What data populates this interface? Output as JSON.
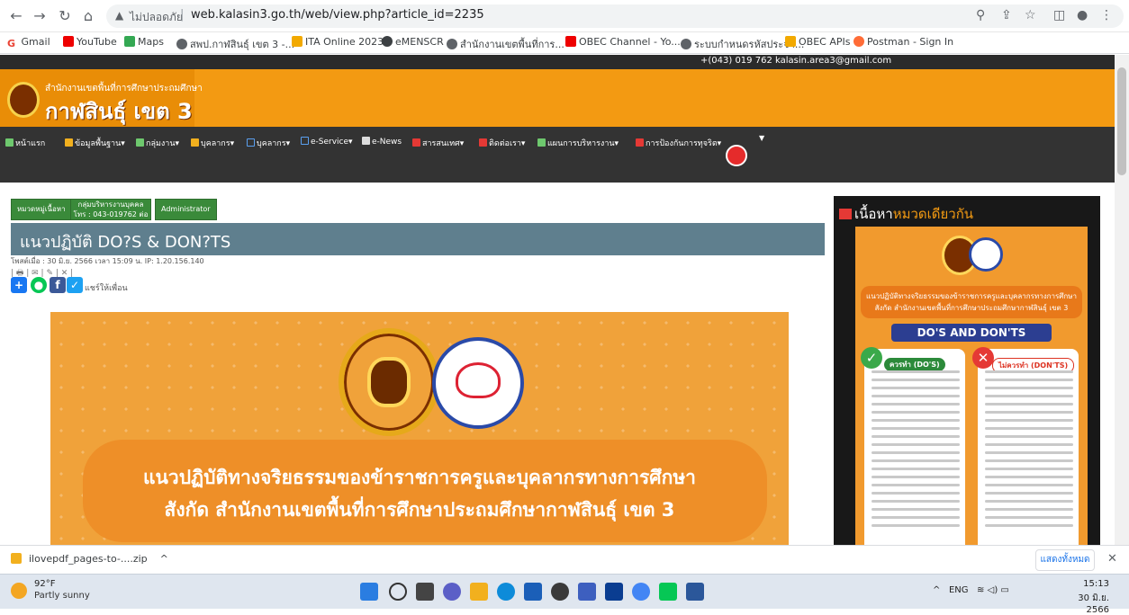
{
  "browser": {
    "insecure_label": "ไม่ปลอดภัย",
    "url": "web.kalasin3.go.th/web/view.php?article_id=2235",
    "bookmarks": [
      "Gmail",
      "YouTube",
      "Maps",
      "สพป.กาฬสินธุ์ เขต 3 -...",
      "ITA Online 2023",
      "eMENSCR",
      "สำนักงานเขตพื้นที่การ...",
      "OBEC Channel - Yo...",
      "ระบบกำหนดรหัสประจำ...",
      "OBEC APIs",
      "Postman - Sign In"
    ]
  },
  "site": {
    "contact": "+(043) 019 762  kalasin.area3@gmail.com",
    "subtitle": "สำนักงานเขตพื้นที่การศึกษาประถมศึกษา",
    "name": "กาฬสินธุ์ เขต 3",
    "nav": [
      "หน้าแรก",
      "ข้อมูลพื้นฐาน▾",
      "กลุ่มงาน▾",
      "บุคลากร▾",
      "บุคลากร▾",
      "e-Service▾",
      "e-News",
      "สารสนเทศ▾",
      "ติดต่อเรา▾",
      "แผนการบริหารงาน▾",
      "การป้องกันการทุจริต▾"
    ],
    "colors": {
      "header": "#f39a12",
      "nav": "#333333",
      "title_bar": "#5f7f8e"
    }
  },
  "article": {
    "tags": [
      "หมวดหมู่เนื้อหา",
      "กลุ่มบริหารงานบุคคล\nโทร : 043-019762 ต่อ 4",
      "Administrator"
    ],
    "title": "แนวปฏิบัติ DO?S & DON?TS",
    "meta": "โพสต์เมื่อ : 30 มิ.ย. 2566 เวลา 15:09 น. IP: 1.20.156.140",
    "tools": "| 🖶 | ✉ | ✎ | ✕ |",
    "share_label": "แชร์ให้เพื่อน",
    "banner_line1": "แนวปฏิบัติทางจริยธรรมของข้าราชการครูและบุคลากรทางการศึกษา",
    "banner_line2": "สังกัด สำนักงานเขตพื้นที่การศึกษาประถมศึกษากาฬสินธุ์ เขต 3"
  },
  "sidebar": {
    "title_prefix": "เนื้อหา",
    "title_highlight": "หมวดเดียวกัน",
    "poster_heading": "แนวปฏิบัติทางจริยธรรมของข้าราชการครูและบุคลากรทางการศึกษา\nสังกัด สำนักงานเขตพื้นที่การศึกษาประถมศึกษากาฬสินธุ์ เขต 3",
    "poster_title": "DO'S AND DON'TS",
    "dos_label": "ควรทำ (DO'S)",
    "donts_label": "ไม่ควรทำ (DON'TS)"
  },
  "downloads": {
    "file": "ilovepdf_pages-to-....zip",
    "show_all": "แสดงทั้งหมด"
  },
  "taskbar": {
    "temperature": "92°F",
    "weather": "Partly sunny",
    "language": "ENG",
    "time": "15:13",
    "date": "30 มิ.ย. 2566"
  }
}
